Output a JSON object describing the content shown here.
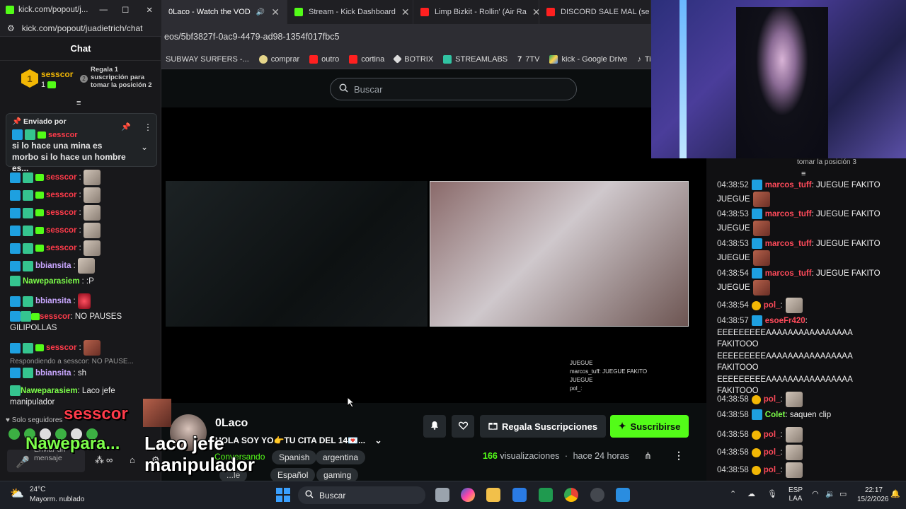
{
  "popout": {
    "title": "kick.com/popout/j...",
    "url": "kick.com/popout/juadietrich/chat",
    "header": "Chat",
    "leader": {
      "name": "sesscor",
      "count": "1",
      "cta": "Regala 1 suscripción para tomar la posición 2",
      "rank_badge": "2"
    },
    "pinned": {
      "label": "Enviado por",
      "user": "sesscor",
      "text": "si lo hace una mina es morbo si lo hace un hombre es..."
    },
    "messages": [
      {
        "user": "sesscor",
        "color": "red",
        "text": ":",
        "emote": "cat"
      },
      {
        "user": "sesscor",
        "color": "red",
        "text": ":",
        "emote": "cat"
      },
      {
        "user": "sesscor",
        "color": "red",
        "text": ":",
        "emote": "cat"
      },
      {
        "user": "sesscor",
        "color": "red",
        "text": ":",
        "emote": "cat"
      },
      {
        "user": "sesscor",
        "color": "red",
        "text": ":",
        "emote": "cat"
      },
      {
        "user": "bbiansita",
        "color": "purple",
        "text": ":",
        "emote": "cat"
      },
      {
        "user": "Naweparasiem",
        "color": "green",
        "text": ": :P"
      },
      {
        "user": "bbiansita",
        "color": "purple",
        "text": ":",
        "emote": "fire"
      },
      {
        "user": "sesscor",
        "color": "red",
        "text": ": NO PAUSES GILIPOLLAS"
      },
      {
        "user": "sesscor",
        "color": "red",
        "text": ":",
        "emote": "red"
      },
      {
        "reply": "Respondiendo a sesscor: NO PAUSE..."
      },
      {
        "user": "bbiansita",
        "color": "purple",
        "text": ": sh"
      },
      {
        "user": "Naweparasiem",
        "color": "green",
        "text": ": Laco jefe manipulador"
      }
    ],
    "followers_only": "Solo seguidores",
    "input_placeholder": "Enviar un mensaje"
  },
  "overlay": {
    "big_user": "sesscor",
    "big_user2": "Nawepara...",
    "big_msg": "Laco jefe manipulador"
  },
  "browser": {
    "tabs": [
      {
        "label": "0Laco - Watch the VOD",
        "icon": "kick-icon",
        "active": true
      },
      {
        "label": "Stream - Kick Dashboard",
        "icon": "kick-icon",
        "active": false
      },
      {
        "label": "Limp Bizkit - Rollin' (Air Ra",
        "icon": "youtube-icon",
        "active": false
      },
      {
        "label": "DISCORD SALE MAL (se pe",
        "icon": "youtube-icon",
        "active": false
      }
    ],
    "url": "eos/5bf3827f-0ac9-4479-ad98-1354f017fbc5",
    "bookmarks": [
      "SUBWAY SURFERS -...",
      "comprar",
      "outro",
      "cortina",
      "BOTRIX",
      "STREAMLABS",
      "7TV",
      "kick - Google Drive",
      "TikTok"
    ]
  },
  "kick": {
    "search_placeholder": "Buscar",
    "mini_chat": [
      "JUEGUE",
      "marcos_tuff: JUEGUE FAKITO",
      "JUEGUE",
      "pol_:"
    ],
    "channel": "0Laco",
    "title": "HOLA SOY YO👉TU CITA DEL 14💌...",
    "category": "Conversando",
    "tags": [
      "Spanish",
      "argentina",
      "Español",
      "gaming"
    ],
    "tag_partial": "...le",
    "gift_btn": "Regala Suscripciones",
    "sub_btn": "Suscribirse",
    "views_count": "166",
    "views_label": "visualizaciones",
    "time_ago": "hace 24 horas"
  },
  "right_chat": {
    "header_partial": "tomar la posición 3",
    "messages": [
      {
        "time": "04:38:52",
        "user": "marcos_tuff",
        "text": ": JUEGUE FAKITO JUEGUE"
      },
      {
        "time": "04:38:53",
        "user": "marcos_tuff",
        "text": ": JUEGUE FAKITO JUEGUE"
      },
      {
        "time": "04:38:53",
        "user": "marcos_tuff",
        "text": ": JUEGUE FAKITO JUEGUE"
      },
      {
        "time": "04:38:54",
        "user": "marcos_tuff",
        "text": ": JUEGUE FAKITO JUEGUE"
      },
      {
        "time": "04:38:54",
        "user": "pol_",
        "text": ":"
      },
      {
        "time": "04:38:57",
        "user": "esoeFr420",
        "text": ": EEEEEEEEEAAAAAAAAAAAAAAAA FAKITOOO EEEEEEEEEAAAAAAAAAAAAAAAA FAKITOOO EEEEEEEEEAAAAAAAAAAAAAAAA FAKITOOO"
      },
      {
        "time": "04:38:58",
        "user": "pol_",
        "text": ":"
      },
      {
        "time": "04:38:58",
        "user": "Colet",
        "text": ": saquen clip"
      },
      {
        "time": "04:38:58",
        "user": "pol_",
        "text": ":"
      },
      {
        "time": "04:38:58",
        "user": "pol_",
        "text": ":"
      },
      {
        "time": "04:38:58",
        "user": "pol_",
        "text": ":"
      }
    ]
  },
  "taskbar": {
    "weather_temp": "24°C",
    "weather_desc": "Mayorm. nublado",
    "search": "Buscar",
    "lang1": "ESP",
    "lang2": "LAA",
    "time": "22:17",
    "date": "15/2/2026"
  },
  "colors": {
    "kick_green": "#53fc18",
    "mod_blue": "#1ea0e0",
    "user_red": "#ff3b4a"
  }
}
